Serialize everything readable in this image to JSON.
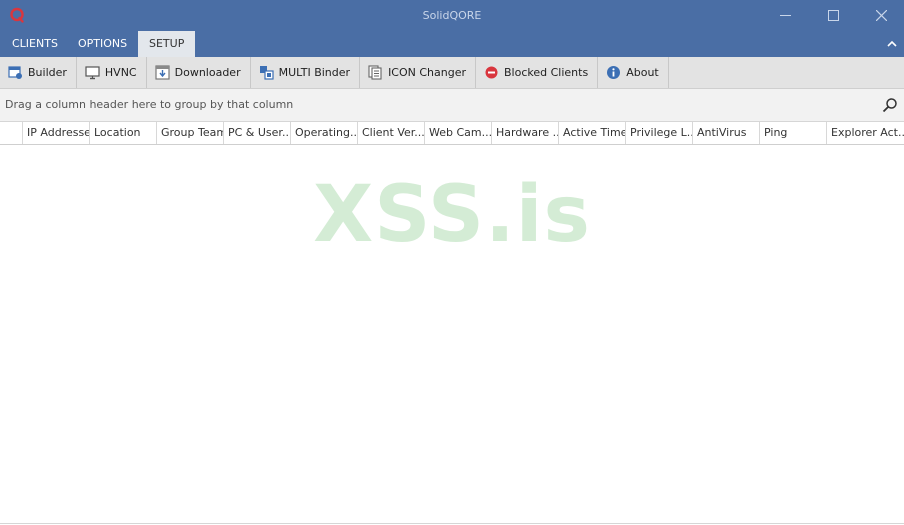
{
  "window": {
    "title": "SolidQORE",
    "icon": "red-q-logo-icon",
    "controls": [
      "minimize-icon",
      "maximize-icon",
      "close-icon"
    ]
  },
  "menu": {
    "tabs": [
      {
        "label": "CLIENTS"
      },
      {
        "label": "OPTIONS"
      },
      {
        "label": "SETUP",
        "active": true
      }
    ]
  },
  "toolbar": {
    "buttons": [
      {
        "label": "Builder",
        "icon": "builder-icon"
      },
      {
        "label": "HVNC",
        "icon": "monitor-icon"
      },
      {
        "label": "Downloader",
        "icon": "download-icon"
      },
      {
        "label": "MULTI Binder",
        "icon": "binder-icon"
      },
      {
        "label": "ICON Changer",
        "icon": "document-icon"
      },
      {
        "label": "Blocked Clients",
        "icon": "blocked-icon"
      },
      {
        "label": "About",
        "icon": "info-icon"
      }
    ]
  },
  "grid": {
    "group_hint": "Drag a column header here to group by that column",
    "columns": [
      "IP Addresse",
      "Location",
      "Group Team",
      "PC & User...",
      "Operating...",
      "Client Ver...",
      "Web Cam...",
      "Hardware ...",
      "Active Time",
      "Privilege L...",
      "AntiVirus",
      "Ping",
      "Explorer Act..."
    ],
    "watermark": "XSS.is"
  },
  "colors": {
    "titlebar": "#4a6ea5",
    "toolbar": "#e3e3e3",
    "watermark": "#d4ecd5",
    "logo": "#d9363e"
  }
}
